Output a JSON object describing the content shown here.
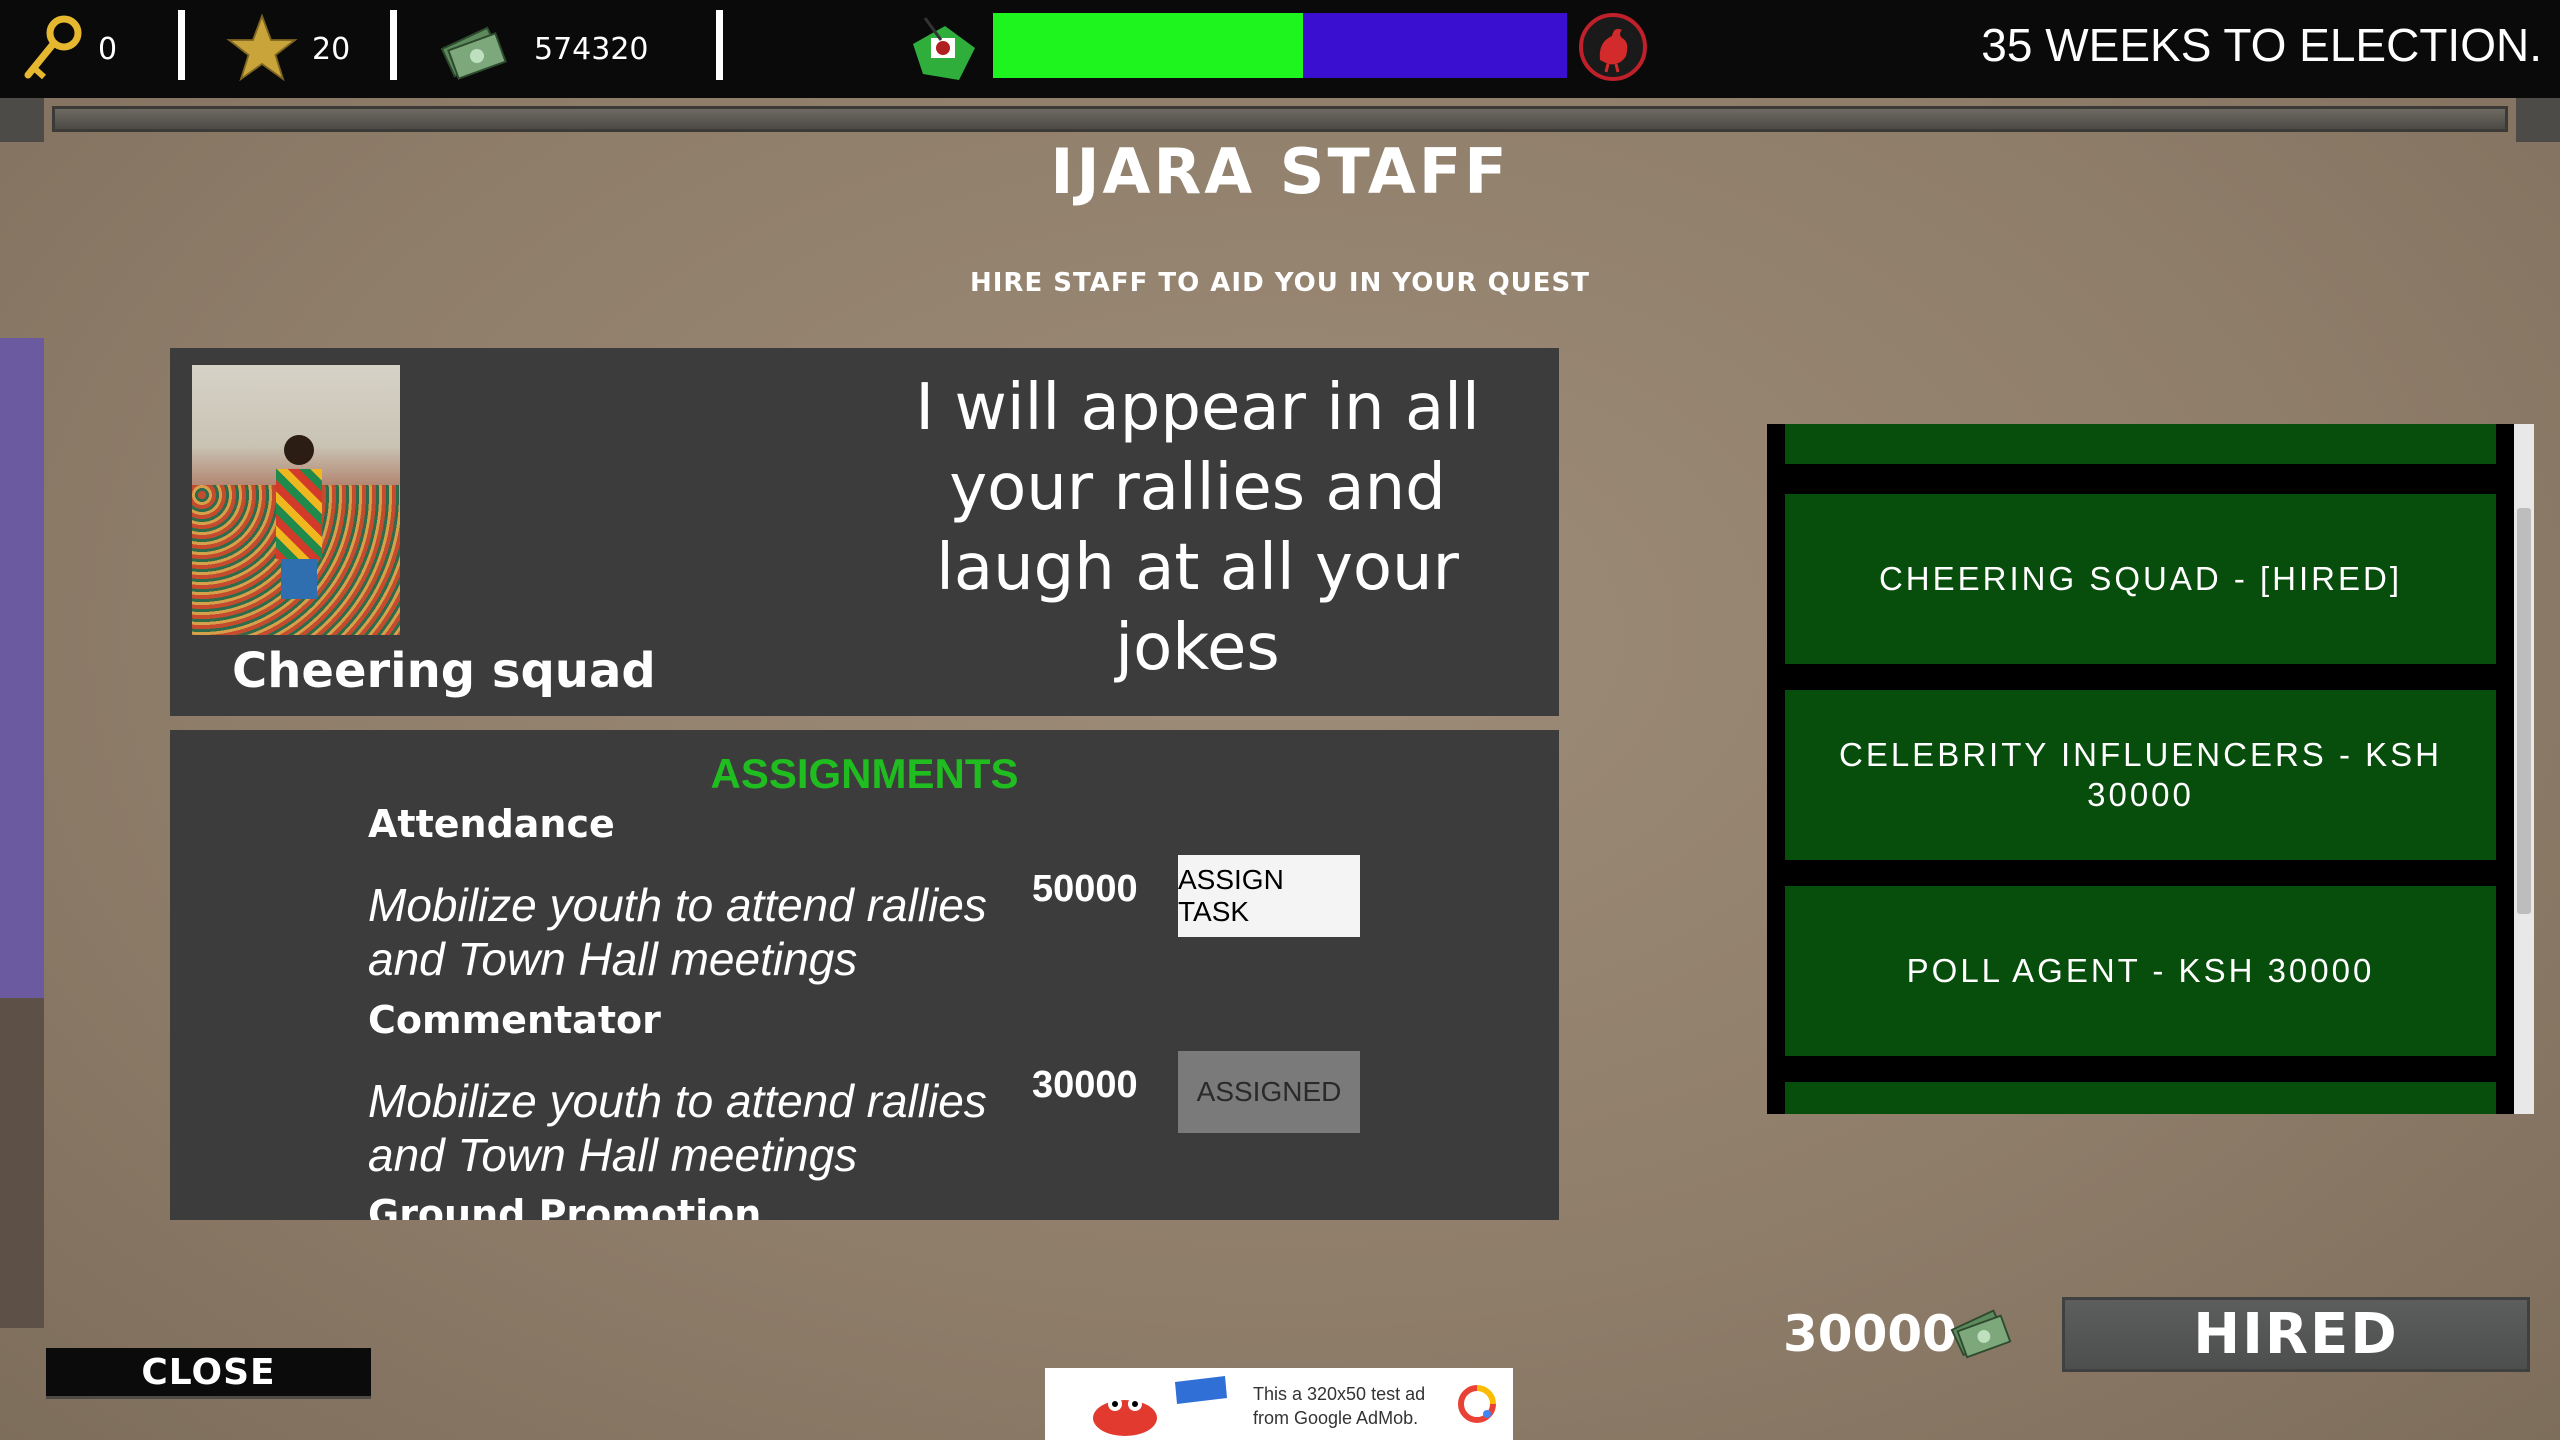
{
  "hud": {
    "keys_count": "0",
    "stars_count": "20",
    "money": "574320",
    "election_text": "35 WEEKS TO ELECTION.",
    "meter_fraction": 0.54,
    "colors": {
      "meter_left": "#1ef51e",
      "meter_right": "#3a0fcf"
    },
    "icons": [
      "key-icon",
      "star-icon",
      "cash-icon",
      "party-flag-icon",
      "rooster-icon"
    ]
  },
  "panel": {
    "title": "IJARA STAFF",
    "subtitle": "HIRE STAFF TO AID YOU IN YOUR QUEST"
  },
  "selected_staff": {
    "name": "Cheering squad",
    "description": "I will appear in all your rallies and laugh at all your jokes",
    "price": "30000",
    "action_label": "HIRED"
  },
  "assignments": {
    "heading": "ASSIGNMENTS",
    "tasks": [
      {
        "name": "Attendance",
        "description": "Mobilize youth to attend rallies and Town Hall meetings",
        "cost": "50000",
        "button": "ASSIGN TASK"
      },
      {
        "name": "Commentator",
        "description": "Mobilize youth to attend rallies and Town Hall meetings",
        "cost": "30000",
        "button": "ASSIGNED"
      },
      {
        "name": "Ground Promotion"
      }
    ]
  },
  "staff_list": [
    {
      "label": ""
    },
    {
      "label": "CHEERING SQUAD - [HIRED]"
    },
    {
      "label": "CELEBRITY INFLUENCERS - KSH 30000"
    },
    {
      "label": "POLL AGENT - KSH 30000"
    },
    {
      "label": ""
    }
  ],
  "footer": {
    "close_label": "CLOSE",
    "ad_text_line1": "This a 320x50 test ad",
    "ad_text_line2": "from Google AdMob."
  }
}
